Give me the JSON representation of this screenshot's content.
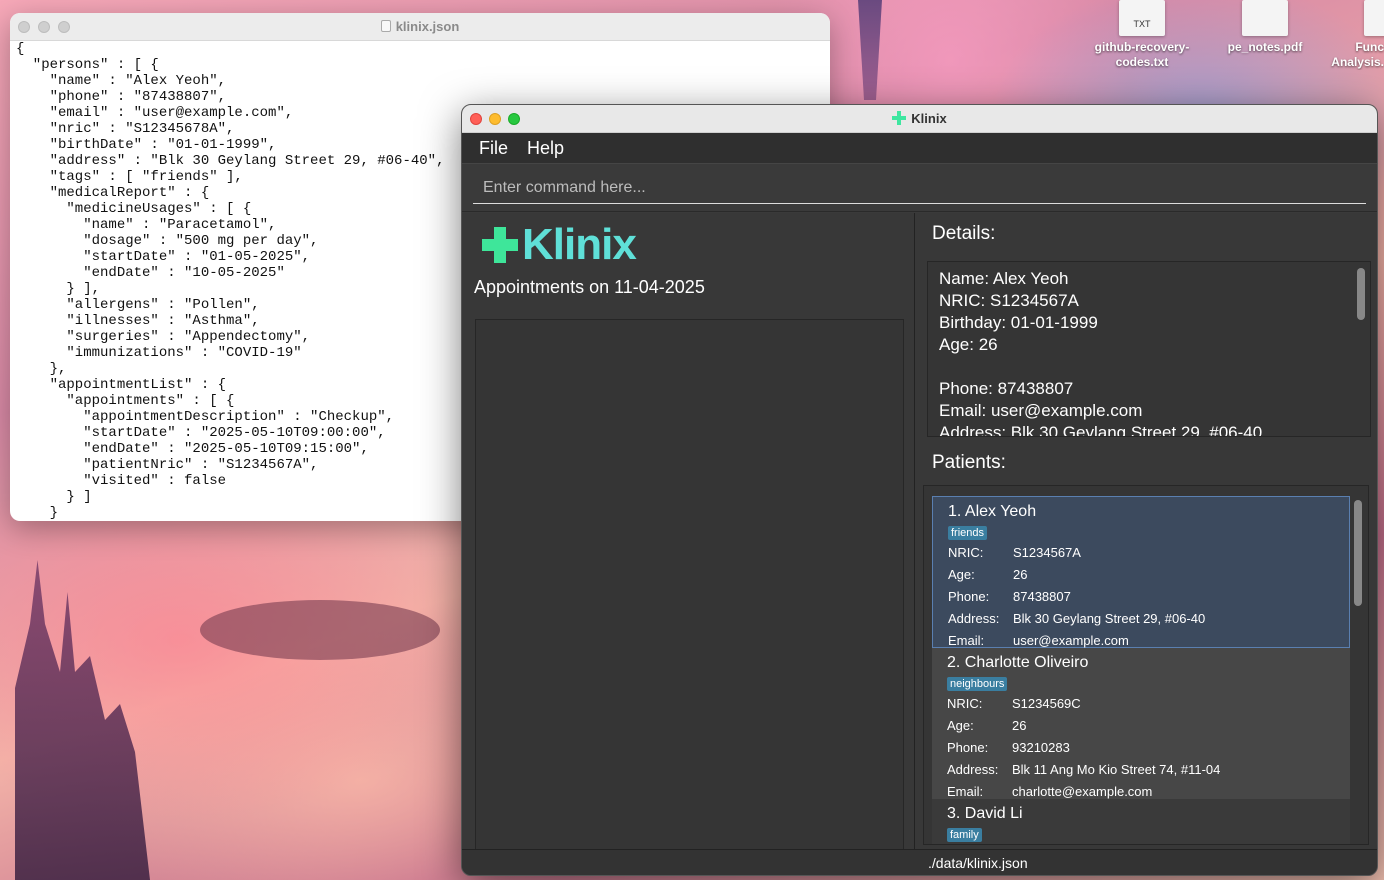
{
  "desktop": {
    "icons": [
      {
        "thumb": "TXT",
        "label_line1": "github-recovery-",
        "label_line2": "codes.txt"
      },
      {
        "thumb": "",
        "label_line1": "pe_notes.pdf",
        "label_line2": ""
      },
      {
        "thumb": "",
        "label_line1": "Func",
        "label_line2": "Analysis."
      }
    ]
  },
  "editor": {
    "title": "klinix.json",
    "content": "{\n  \"persons\" : [ {\n    \"name\" : \"Alex Yeoh\",\n    \"phone\" : \"87438807\",\n    \"email\" : \"user@example.com\",\n    \"nric\" : \"S12345678A\",\n    \"birthDate\" : \"01-01-1999\",\n    \"address\" : \"Blk 30 Geylang Street 29, #06-40\",\n    \"tags\" : [ \"friends\" ],\n    \"medicalReport\" : {\n      \"medicineUsages\" : [ {\n        \"name\" : \"Paracetamol\",\n        \"dosage\" : \"500 mg per day\",\n        \"startDate\" : \"01-05-2025\",\n        \"endDate\" : \"10-05-2025\"\n      } ],\n      \"allergens\" : \"Pollen\",\n      \"illnesses\" : \"Asthma\",\n      \"surgeries\" : \"Appendectomy\",\n      \"immunizations\" : \"COVID-19\"\n    },\n    \"appointmentList\" : {\n      \"appointments\" : [ {\n        \"appointmentDescription\" : \"Checkup\",\n        \"startDate\" : \"2025-05-10T09:00:00\",\n        \"endDate\" : \"2025-05-10T09:15:00\",\n        \"patientNric\" : \"S1234567A\",\n        \"visited\" : false\n      } ]\n    }"
  },
  "klinix": {
    "title": "Klinix",
    "menu": {
      "file": "File",
      "help": "Help"
    },
    "command": {
      "placeholder": "Enter command here..."
    },
    "logo_text": "Klinix",
    "appointments_heading": "Appointments on 11-04-2025",
    "details_label": "Details:",
    "details": {
      "name": "Name: Alex Yeoh",
      "nric": "NRIC: S1234567A",
      "birthday": "Birthday: 01-01-1999",
      "age": "Age: 26",
      "phone": "Phone: 87438807",
      "email": "Email: user@example.com",
      "address": "Address: Blk 30 Geylang Street 29, #06-40"
    },
    "patients_label": "Patients:",
    "field_labels": {
      "nric": "NRIC:",
      "age": "Age:",
      "phone": "Phone:",
      "address": "Address:",
      "email": "Email:"
    },
    "patients": [
      {
        "title": "1. Alex Yeoh",
        "tag": "friends",
        "nric": "S1234567A",
        "age": "26",
        "phone": "87438807",
        "address": "Blk 30 Geylang Street 29, #06-40",
        "email": "user@example.com"
      },
      {
        "title": "2. Charlotte Oliveiro",
        "tag": "neighbours",
        "nric": "S1234569C",
        "age": "26",
        "phone": "93210283",
        "address": "Blk 11 Ang Mo Kio Street 74, #11-04",
        "email": "charlotte@example.com"
      },
      {
        "title": "3. David Li",
        "tag": "family"
      }
    ],
    "status": "./data/klinix.json"
  }
}
